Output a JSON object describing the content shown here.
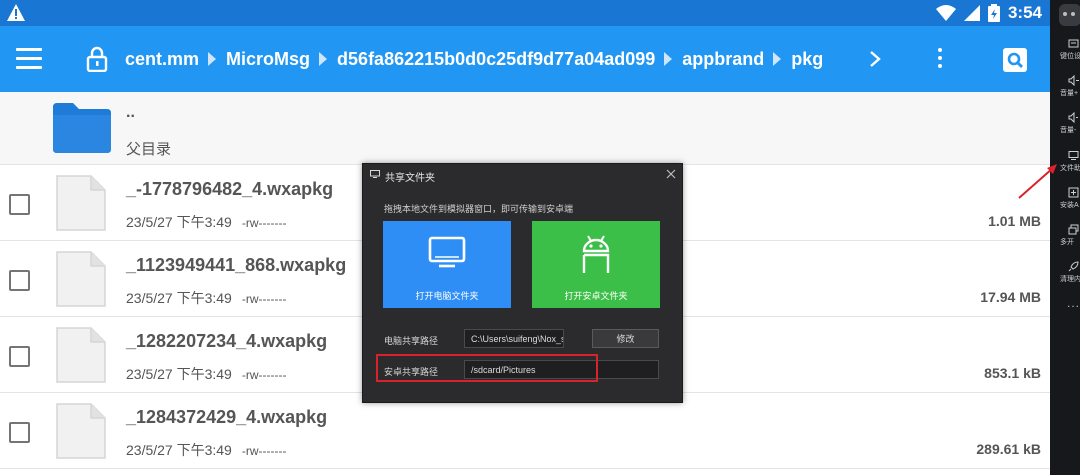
{
  "status_bar": {
    "time": "3:54"
  },
  "app_bar": {
    "breadcrumbs": [
      "cent.mm",
      "MicroMsg",
      "d56fa862215b0d0c25df9d77a04ad099",
      "appbrand",
      "pkg"
    ]
  },
  "parent_dir": {
    "name": "..",
    "label": "父目录"
  },
  "files": [
    {
      "name": "_-1778796482_4.wxapkg",
      "date": "23/5/27 下午3:49",
      "perm": "-rw-------",
      "size": "1.01 MB"
    },
    {
      "name": "_1123949441_868.wxapkg",
      "date": "23/5/27 下午3:49",
      "perm": "-rw-------",
      "size": "17.94 MB"
    },
    {
      "name": "_1282207234_4.wxapkg",
      "date": "23/5/27 下午3:49",
      "perm": "-rw-------",
      "size": "853.1 kB"
    },
    {
      "name": "_1284372429_4.wxapkg",
      "date": "23/5/27 下午3:49",
      "perm": "-rw-------",
      "size": "289.61 kB"
    }
  ],
  "dialog": {
    "title": "共享文件夹",
    "description": "拖拽本地文件到模拟器窗口，即可传输到安卓端",
    "pc_button": "打开电脑文件夹",
    "android_button": "打开安卓文件夹",
    "pc_path_label": "电脑共享路径",
    "pc_path_value": "C:\\Users\\suifeng\\Nox_sha",
    "modify_button": "修改",
    "android_path_label": "安卓共享路径",
    "android_path_value": "/sdcard/Pictures"
  },
  "sidebar": {
    "items": [
      {
        "label": "键位设"
      },
      {
        "label": "音量+"
      },
      {
        "label": "音量-"
      },
      {
        "label": "文件助"
      },
      {
        "label": "安装A"
      },
      {
        "label": "多开"
      },
      {
        "label": "清理内"
      }
    ],
    "more": "..."
  },
  "colors": {
    "status_bar": "#1976d2",
    "app_bar": "#2196f3",
    "folder": "#1e7bd8",
    "dialog_bg": "#2b2b2d",
    "pc_tile": "#2f8ef6",
    "android_tile": "#3cbf48",
    "highlight": "#d9222a"
  }
}
